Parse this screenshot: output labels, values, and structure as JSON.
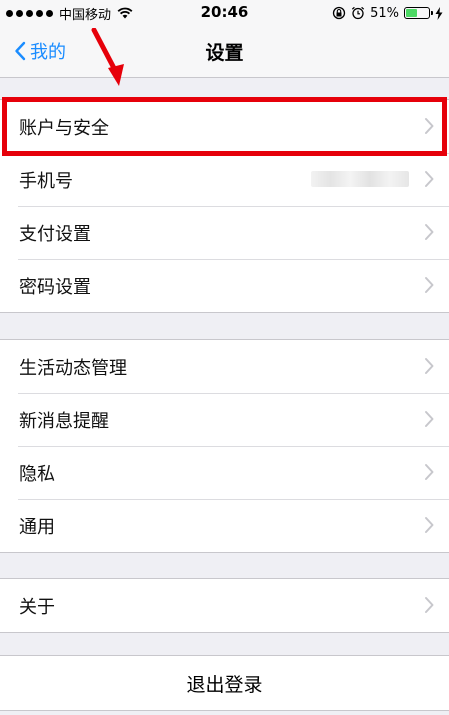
{
  "status_bar": {
    "carrier": "中国移动",
    "time": "20:46",
    "battery_percent_label": "51%",
    "battery_level": 0.51,
    "battery_color": "#4cd964",
    "icons": [
      "signal-dots-icon",
      "wifi-icon",
      "orientation-lock-icon",
      "alarm-icon",
      "battery-icon",
      "charging-bolt-icon"
    ]
  },
  "nav": {
    "back_label": "我的",
    "title": "设置",
    "accent_color": "#1a8cff"
  },
  "groups": [
    {
      "items": [
        {
          "label": "账户与安全",
          "highlighted": true
        },
        {
          "label": "手机号",
          "value_masked": true
        },
        {
          "label": "支付设置"
        },
        {
          "label": "密码设置"
        }
      ]
    },
    {
      "items": [
        {
          "label": "生活动态管理"
        },
        {
          "label": "新消息提醒"
        },
        {
          "label": "隐私"
        },
        {
          "label": "通用"
        }
      ]
    },
    {
      "items": [
        {
          "label": "关于"
        }
      ]
    }
  ],
  "logout_label": "退出登录",
  "annotation": {
    "highlight_color": "#e6000a",
    "arrow_icon": "red-arrow-down-icon"
  }
}
